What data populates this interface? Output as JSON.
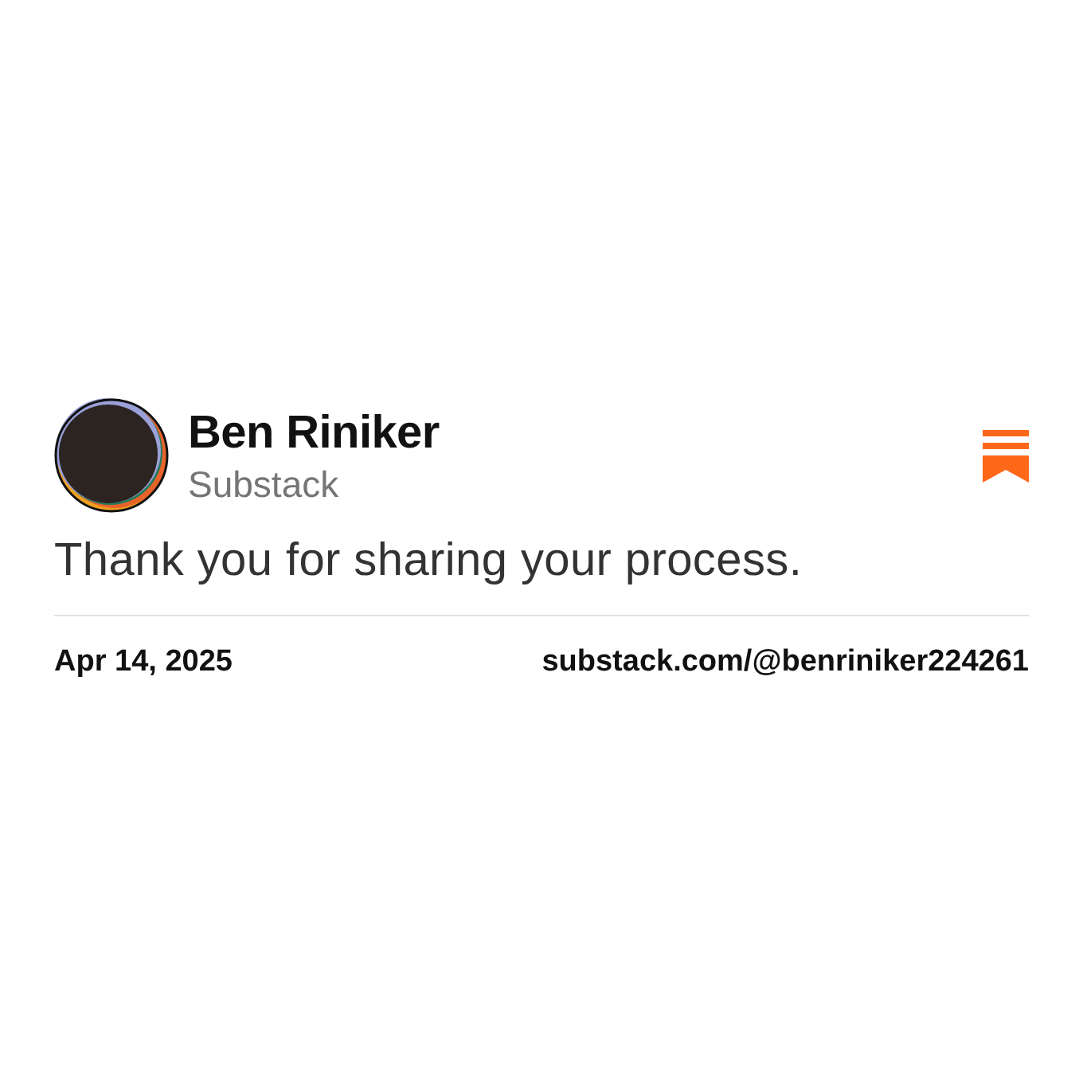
{
  "author": {
    "name": "Ben Riniker",
    "publication": "Substack"
  },
  "note": {
    "text": "Thank you for sharing your process."
  },
  "footer": {
    "date": "Apr 14, 2025",
    "link": "substack.com/@benriniker224261"
  }
}
